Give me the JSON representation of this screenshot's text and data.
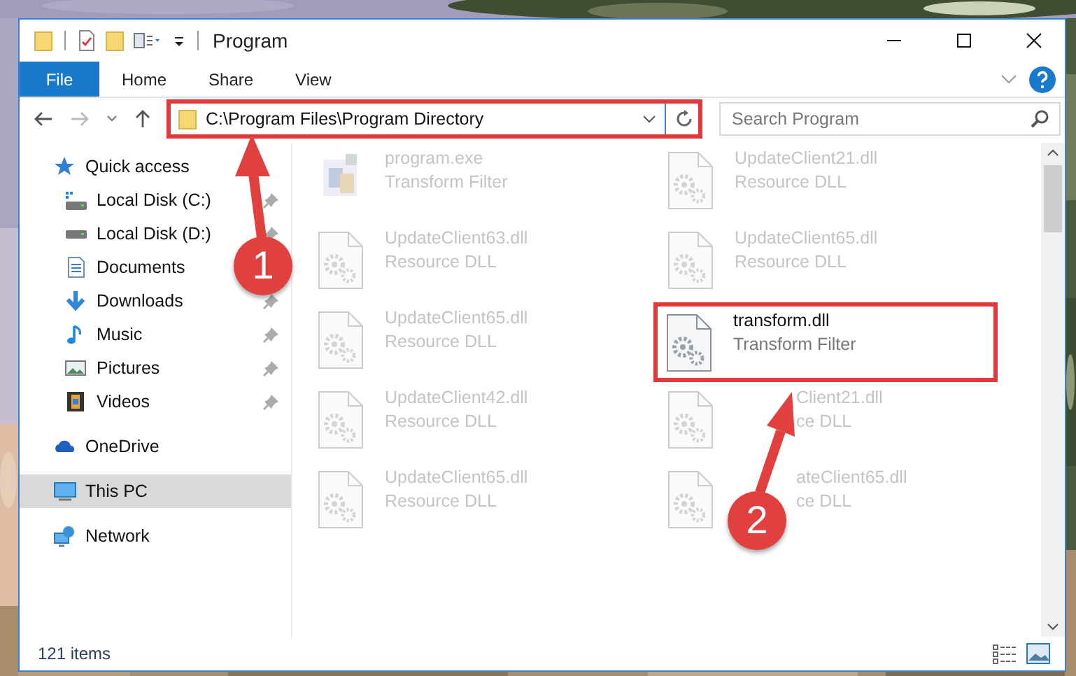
{
  "window": {
    "title": "Program"
  },
  "ribbon_tabs": [
    {
      "label": "File",
      "kind": "file",
      "selected": false
    },
    {
      "label": "Home",
      "kind": "tab",
      "selected": false
    },
    {
      "label": "Share",
      "kind": "tab",
      "selected": false
    },
    {
      "label": "View",
      "kind": "tab",
      "selected": false
    }
  ],
  "address_bar": {
    "path": "C:\\Program Files\\Program Directory",
    "highlighted": true
  },
  "search": {
    "placeholder": "Search Program"
  },
  "sidebar": {
    "items": [
      {
        "label": "Quick access",
        "kind": "quick",
        "pinned": false,
        "selected": false,
        "children": [
          {
            "label": "Local Disk (C:)",
            "kind": "disk-c",
            "pinned": true,
            "selected": false
          },
          {
            "label": "Local Disk (D:)",
            "kind": "disk",
            "pinned": true,
            "selected": false
          },
          {
            "label": "Documents",
            "kind": "documents",
            "pinned": false,
            "selected": false
          },
          {
            "label": "Downloads",
            "kind": "downloads",
            "pinned": true,
            "selected": false
          },
          {
            "label": "Music",
            "kind": "music",
            "pinned": true,
            "selected": false
          },
          {
            "label": "Pictures",
            "kind": "pictures",
            "pinned": true,
            "selected": false
          },
          {
            "label": "Videos",
            "kind": "videos",
            "pinned": true,
            "selected": false
          }
        ]
      },
      {
        "label": "OneDrive",
        "kind": "onedrive",
        "pinned": false,
        "selected": false
      },
      {
        "label": "This PC",
        "kind": "pc",
        "pinned": false,
        "selected": true
      },
      {
        "label": "Network",
        "kind": "network",
        "pinned": false,
        "selected": false
      }
    ]
  },
  "files": [
    {
      "name": "program.exe",
      "type": "Transform Filter",
      "kind": "exe",
      "blurred": true,
      "highlighted": false
    },
    {
      "name": "UpdateClient21.dll",
      "type": "Resource DLL",
      "kind": "dll",
      "blurred": true,
      "highlighted": false
    },
    {
      "name": "UpdateClient63.dll",
      "type": "Resource DLL",
      "kind": "dll",
      "blurred": true,
      "highlighted": false
    },
    {
      "name": "UpdateClient65.dll",
      "type": "Resource DLL",
      "kind": "dll",
      "blurred": true,
      "highlighted": false
    },
    {
      "name": "UpdateClient65.dll",
      "type": "Resource DLL",
      "kind": "dll",
      "blurred": true,
      "highlighted": false
    },
    {
      "name": "transform.dll",
      "type": "Transform Filter",
      "kind": "dll",
      "blurred": false,
      "highlighted": true
    },
    {
      "name": "UpdateClient42.dll",
      "type": "Resource DLL",
      "kind": "dll",
      "blurred": true,
      "highlighted": false
    },
    {
      "name": "Client21.dll",
      "type": "ce DLL",
      "kind": "dll",
      "blurred": true,
      "highlighted": false,
      "clipped": true
    },
    {
      "name": "UpdateClient65.dll",
      "type": "Resource DLL",
      "kind": "dll",
      "blurred": true,
      "highlighted": false
    },
    {
      "name": "ateClient65.dll",
      "type": "ce DLL",
      "kind": "dll",
      "blurred": true,
      "highlighted": false,
      "clipped": true
    }
  ],
  "status_bar": {
    "item_count": "121 items"
  },
  "callouts": [
    {
      "number": "1"
    },
    {
      "number": "2"
    }
  ]
}
